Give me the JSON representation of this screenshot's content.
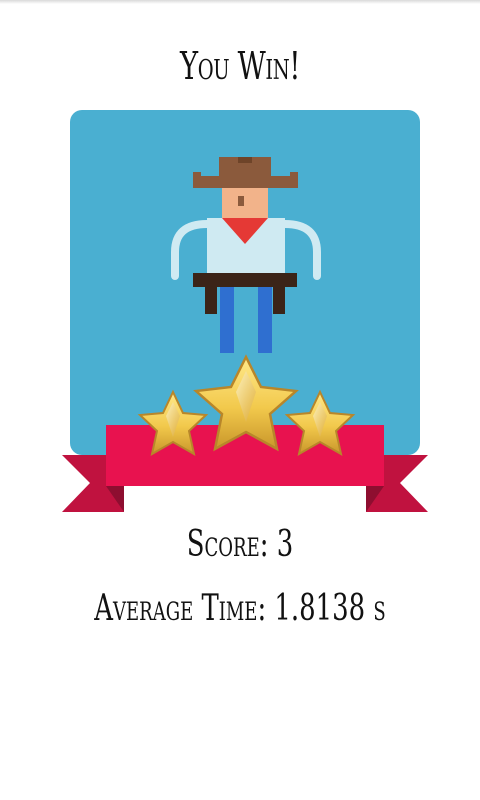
{
  "result": {
    "title": "You Win!",
    "score_label": "Score: 3",
    "average_time_label": "Average Time: 1.8138 s",
    "stars_earned": 3,
    "stars_total": 3
  },
  "colors": {
    "panel_bg": "#4AAFD1",
    "ribbon": "#E8124F",
    "ribbon_dark": "#C0123F",
    "star_gold": "#F2C94C",
    "hat": "#8B5A3C",
    "shirt": "#CFEAF2",
    "bandana": "#E53935",
    "pants": "#2F6FD0",
    "belt": "#3B2418"
  },
  "icons": {
    "character": "cowboy-character-icon",
    "star": "star-icon"
  }
}
